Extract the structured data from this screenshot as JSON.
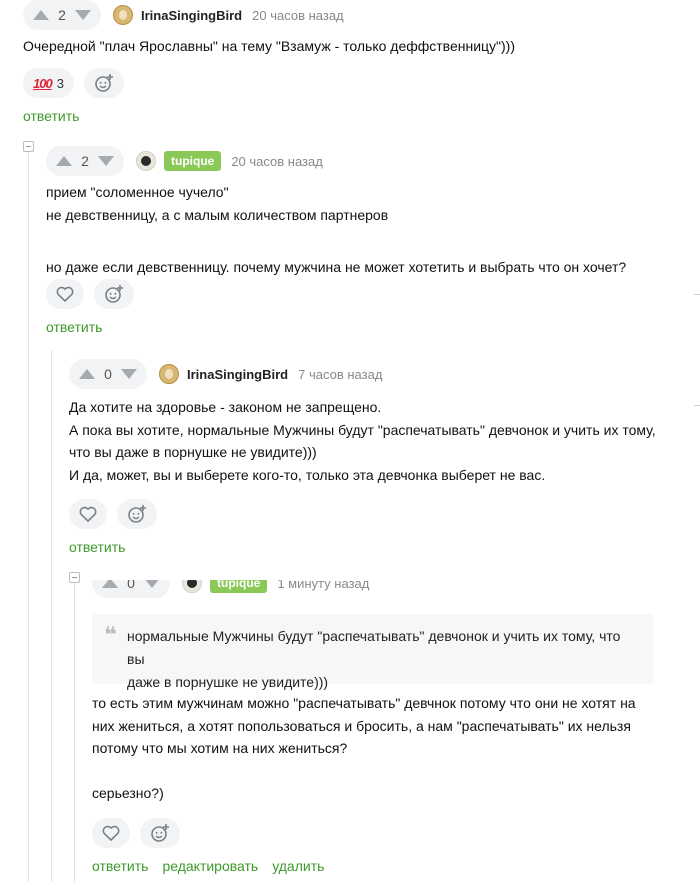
{
  "comments": [
    {
      "votes": "2",
      "author": "IrinaSingingBird",
      "time": "20 часов назад",
      "lines": [
        "Очередной \"плач Ярославны\" на тему \"Взамуж - только деффственницу\")))"
      ],
      "reaction_emoji": "100",
      "reaction_count": "3",
      "links": [
        "ответить"
      ]
    },
    {
      "votes": "2",
      "author": "tupique",
      "time": "20 часов назад",
      "lines": [
        "прием \"соломенное чучело\"",
        "не девственницу, а с малым количеством партнеров",
        "",
        "но даже если девственницу. почему мужчина не может хотетить и выбрать что он хочет?"
      ],
      "links": [
        "ответить"
      ]
    },
    {
      "votes": "0",
      "author": "IrinaSingingBird",
      "time": "7 часов назад",
      "lines": [
        "Да хотите на здоровье - законом не запрещено.",
        "А пока вы хотите, нормальные Мужчины будут \"распечатывать\" девчонок и учить их тому,",
        "что вы даже в порнушке не увидите)))",
        "И да, может, вы и выберете кого-то, только эта девчонка выберет не вас."
      ],
      "links": [
        "ответить"
      ]
    },
    {
      "votes": "0",
      "author": "tupique",
      "time": "1 минуту назад",
      "quote": [
        "нормальные Мужчины будут \"распечатывать\" девчонок и учить их тому, что вы",
        "даже в порнушке не увидите)))"
      ],
      "lines": [
        "то есть этим мужчинам можно \"распечатывать\" девчнок потому что они не хотят на",
        "них жениться, а хотят попользоваться и бросить, а нам \"распечатывать\" их нельзя",
        "потому что мы хотим на них жениться?",
        "",
        "серьезно?)"
      ],
      "links": [
        "ответить",
        "редактировать",
        "удалить"
      ]
    }
  ],
  "colors": {
    "link": "#3e9a2a",
    "author_tag": "#8ac858",
    "pill_bg": "#f2f3f5",
    "vote_arrow": "#a6a9ad"
  },
  "icons": {
    "like": "heart-outline-icon",
    "react": "smiley-plus-icon",
    "upvote": "arrow-up-icon",
    "downvote": "arrow-down-icon",
    "collapse": "collapse-minus-icon"
  }
}
